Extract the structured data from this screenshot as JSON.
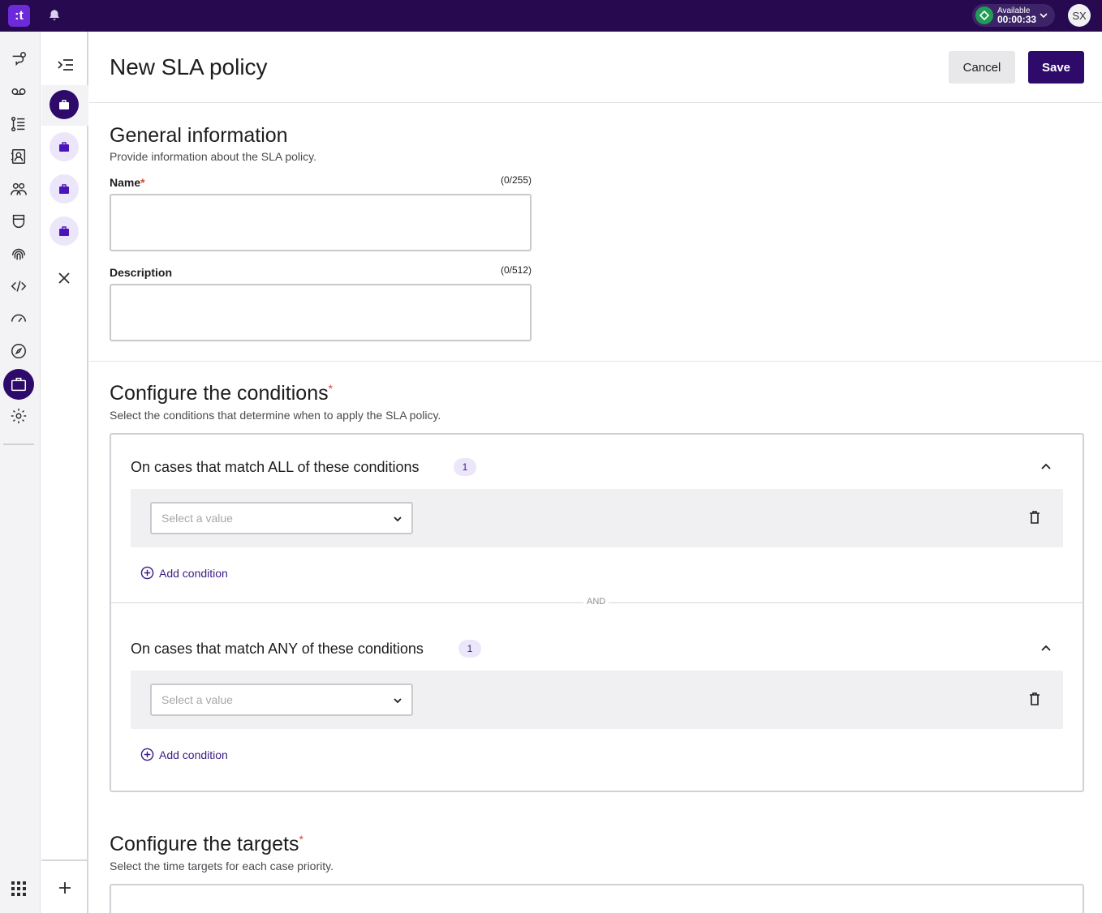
{
  "topbar": {
    "logo_text": ":t",
    "status_label": "Available",
    "status_timer": "00:00:33",
    "avatar_initials": "SX",
    "colors": {
      "bar": "#26094f",
      "accent": "#6b2bd9",
      "status": "#1f9d55"
    }
  },
  "rail": {
    "icons": [
      "conversations-icon",
      "voicemail-icon",
      "queue-list-icon",
      "contacts-icon",
      "teams-icon",
      "shield-icon",
      "fingerprint-icon",
      "code-icon",
      "dashboard-gauge-icon",
      "compass-icon",
      "briefcase-icon",
      "settings-gear-icon"
    ],
    "active": "briefcase-icon"
  },
  "subnav": {
    "items": [
      "briefcase-icon",
      "briefcase-icon",
      "briefcase-icon",
      "briefcase-icon"
    ]
  },
  "header": {
    "title": "New SLA policy",
    "cancel_label": "Cancel",
    "save_label": "Save"
  },
  "general": {
    "title": "General information",
    "description": "Provide information about the SLA policy.",
    "name_label": "Name",
    "name_required": "*",
    "name_counter": "(0/255)",
    "name_value": "",
    "description_label": "Description",
    "description_counter": "(0/512)",
    "description_value": ""
  },
  "conditions": {
    "title": "Configure the conditions",
    "required": "*",
    "description": "Select the conditions that determine when to apply the SLA policy.",
    "all_group": {
      "title": "On cases that match ALL of these conditions",
      "count": "1",
      "select_placeholder": "Select a value",
      "add_label": "Add condition"
    },
    "separator_label": "AND",
    "any_group": {
      "title": "On cases that match ANY of these conditions",
      "count": "1",
      "select_placeholder": "Select a value",
      "add_label": "Add condition"
    }
  },
  "targets": {
    "title": "Configure the targets",
    "required": "*",
    "description": "Select the time targets for each case priority."
  }
}
